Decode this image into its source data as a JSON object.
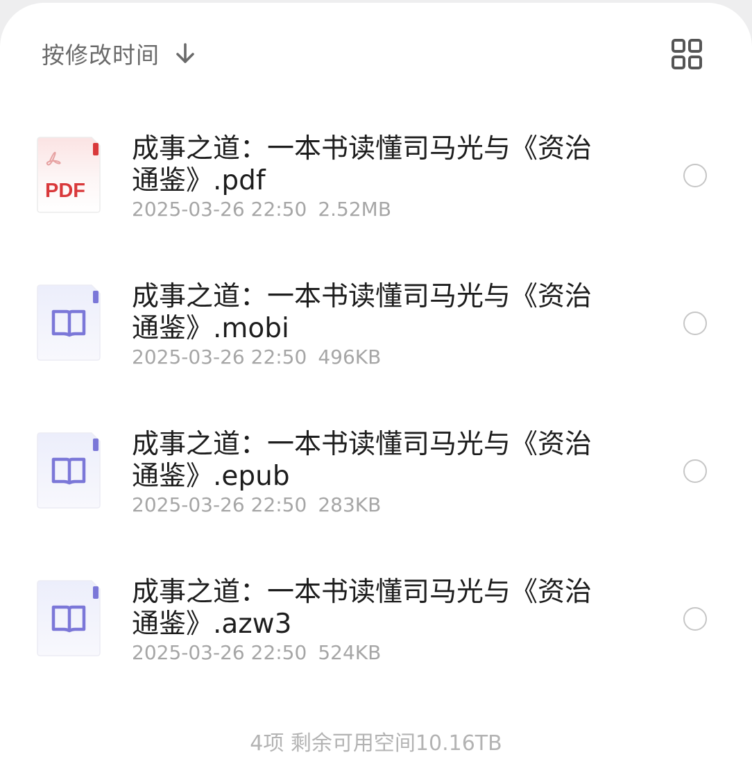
{
  "sort": {
    "label": "按修改时间",
    "arrow_icon": "arrow-down-icon"
  },
  "view_toggle": {
    "icon": "grid-view-icon"
  },
  "files": [
    {
      "name": "成事之道：一本书读懂司马光与《资治通鉴》.pdf",
      "date": "2025-03-26 22:50",
      "size": "2.52MB",
      "icon": "pdf-file-icon",
      "icon_text": "PDF"
    },
    {
      "name": "成事之道：一本书读懂司马光与《资治通鉴》.mobi",
      "date": "2025-03-26 22:50",
      "size": "496KB",
      "icon": "ebook-file-icon"
    },
    {
      "name": "成事之道：一本书读懂司马光与《资治通鉴》.epub",
      "date": "2025-03-26 22:50",
      "size": "283KB",
      "icon": "ebook-file-icon"
    },
    {
      "name": "成事之道：一本书读懂司马光与《资治通鉴》.azw3",
      "date": "2025-03-26 22:50",
      "size": "524KB",
      "icon": "ebook-file-icon"
    }
  ],
  "footer": {
    "text": "4项 剩余可用空间10.16TB"
  },
  "colors": {
    "pdf_red": "#d9393b",
    "ebook_purple": "#7b77d8",
    "name_text": "#1d1d1d",
    "meta_text": "#a6a6a6",
    "sort_text": "#6a6a6a"
  }
}
